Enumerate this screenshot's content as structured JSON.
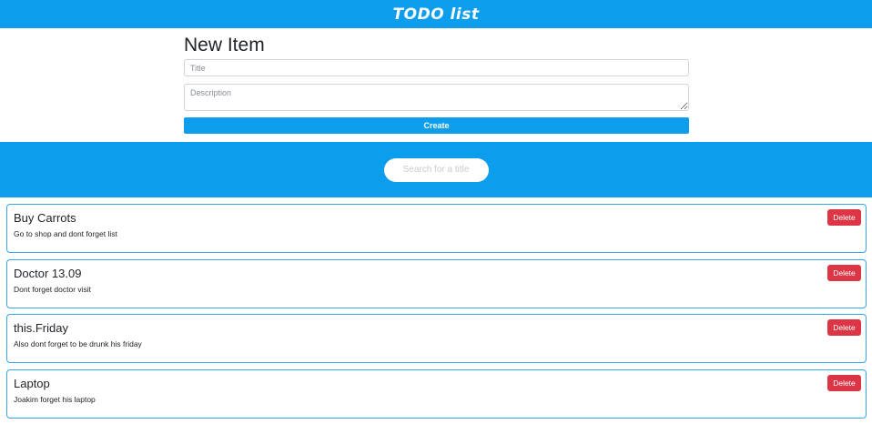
{
  "header": {
    "title": "TODO list"
  },
  "new_item": {
    "heading": "New Item",
    "title_placeholder": "Title",
    "description_placeholder": "Description",
    "create_label": "Create"
  },
  "search": {
    "placeholder": "Search for a title"
  },
  "todos": [
    {
      "title": "Buy Carrots",
      "description": "Go to shop and dont forget list",
      "delete_label": "Delete"
    },
    {
      "title": "Doctor 13.09",
      "description": "Dont forget doctor visit",
      "delete_label": "Delete"
    },
    {
      "title": "this.Friday",
      "description": "Also dont forget to be drunk his friday",
      "delete_label": "Delete"
    },
    {
      "title": "Laptop",
      "description": "Joakim forget his laptop",
      "delete_label": "Delete"
    }
  ],
  "colors": {
    "brand": "#0d9ded",
    "danger": "#dc3545",
    "card_border": "#36a7ec"
  }
}
